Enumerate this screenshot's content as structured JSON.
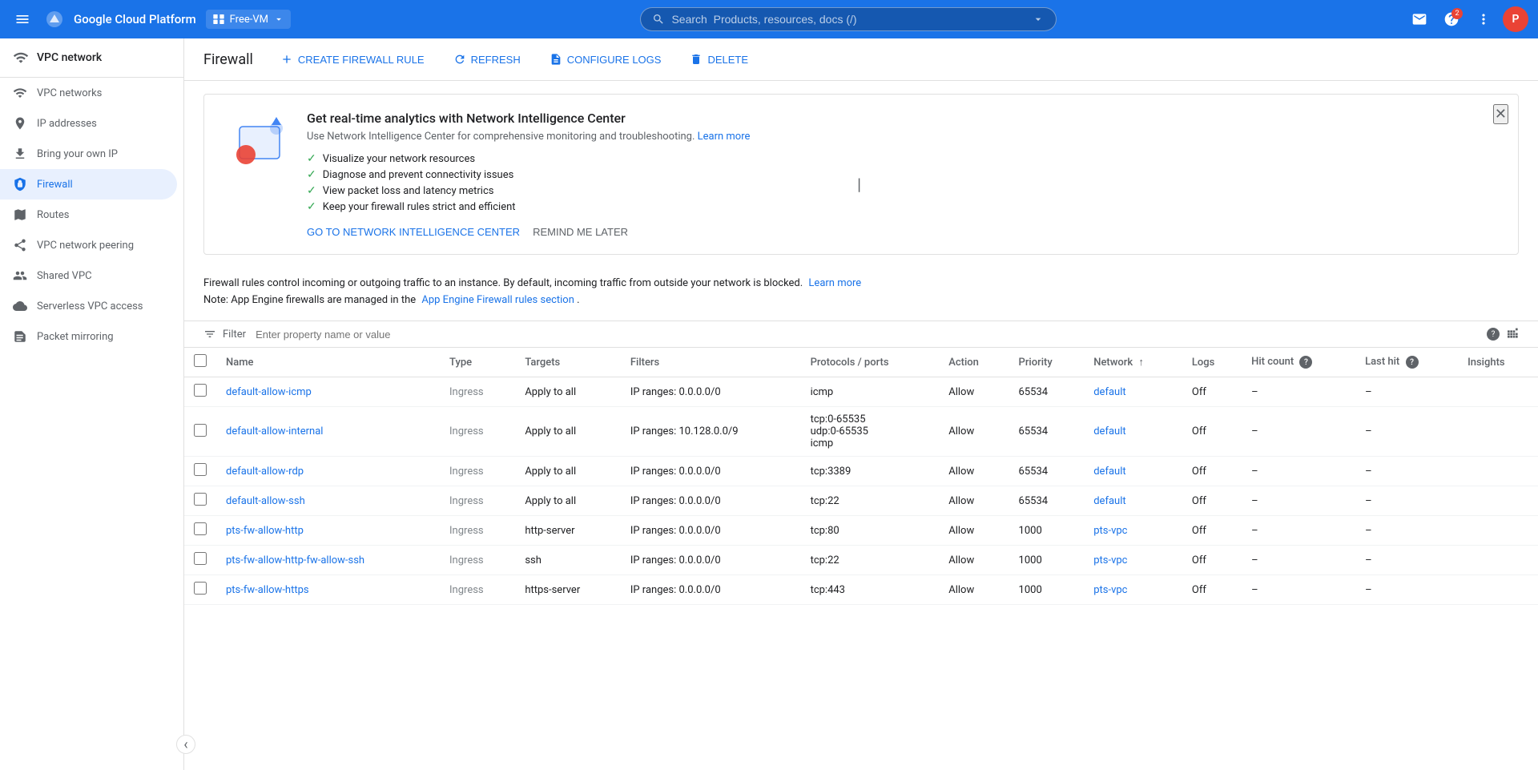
{
  "topbar": {
    "menu_icon": "☰",
    "title": "Google Cloud Platform",
    "project": "Free-VM",
    "search_placeholder": "Search  Products, resources, docs (/)",
    "icons": [
      "✉",
      "?",
      "⋮"
    ],
    "avatar": "P"
  },
  "sidebar": {
    "header": {
      "title": "VPC network"
    },
    "items": [
      {
        "id": "vpc-networks",
        "label": "VPC networks",
        "icon": "network",
        "active": false
      },
      {
        "id": "ip-addresses",
        "label": "IP addresses",
        "icon": "ip",
        "active": false
      },
      {
        "id": "bring-your-own-ip",
        "label": "Bring your own IP",
        "icon": "upload",
        "active": false
      },
      {
        "id": "firewall",
        "label": "Firewall",
        "icon": "shield",
        "active": true
      },
      {
        "id": "routes",
        "label": "Routes",
        "icon": "route",
        "active": false
      },
      {
        "id": "vpc-network-peering",
        "label": "VPC network peering",
        "icon": "peering",
        "active": false
      },
      {
        "id": "shared-vpc",
        "label": "Shared VPC",
        "icon": "shared",
        "active": false
      },
      {
        "id": "serverless-vpc-access",
        "label": "Serverless VPC access",
        "icon": "serverless",
        "active": false
      },
      {
        "id": "packet-mirroring",
        "label": "Packet mirroring",
        "icon": "mirror",
        "active": false
      }
    ]
  },
  "page": {
    "title": "Firewall",
    "toolbar": {
      "create_label": "CREATE FIREWALL RULE",
      "refresh_label": "REFRESH",
      "configure_logs_label": "CONFIGURE LOGS",
      "delete_label": "DELETE"
    },
    "promo": {
      "title": "Get real-time analytics with Network Intelligence Center",
      "subtitle": "Use Network Intelligence Center for comprehensive monitoring and troubleshooting.",
      "subtitle_link": "Learn more",
      "features": [
        "Visualize your network resources",
        "Diagnose and prevent connectivity issues",
        "View packet loss and latency metrics",
        "Keep your firewall rules strict and efficient"
      ],
      "actions": {
        "primary": "GO TO NETWORK INTELLIGENCE CENTER",
        "secondary": "REMIND ME LATER"
      }
    },
    "info": {
      "line1": "Firewall rules control incoming or outgoing traffic to an instance. By default, incoming traffic from outside your network is blocked.",
      "learn_more_1": "Learn more",
      "line2": "Note: App Engine firewalls are managed in the",
      "app_engine_link": "App Engine Firewall rules section",
      "line2_suffix": "."
    },
    "filter": {
      "placeholder": "Enter property name or value"
    },
    "table": {
      "columns": [
        {
          "id": "name",
          "label": "Name"
        },
        {
          "id": "type",
          "label": "Type"
        },
        {
          "id": "targets",
          "label": "Targets"
        },
        {
          "id": "filters",
          "label": "Filters"
        },
        {
          "id": "protocols_ports",
          "label": "Protocols / ports"
        },
        {
          "id": "action",
          "label": "Action"
        },
        {
          "id": "priority",
          "label": "Priority"
        },
        {
          "id": "network",
          "label": "Network",
          "sorted": true
        },
        {
          "id": "logs",
          "label": "Logs"
        },
        {
          "id": "hit_count",
          "label": "Hit count",
          "help": true
        },
        {
          "id": "last_hit",
          "label": "Last hit",
          "help": true
        },
        {
          "id": "insights",
          "label": "Insights"
        }
      ],
      "rows": [
        {
          "name": "default-allow-icmp",
          "type": "Ingress",
          "targets": "Apply to all",
          "filters": "IP ranges: 0.0.0.0/0",
          "protocols_ports": "icmp",
          "action": "Allow",
          "priority": "65534",
          "network": "default",
          "logs": "Off",
          "hit_count": "–",
          "last_hit": "–",
          "insights": ""
        },
        {
          "name": "default-allow-internal",
          "type": "Ingress",
          "targets": "Apply to all",
          "filters": "IP ranges: 10.128.0.0/9",
          "protocols_ports": "tcp:0-65535\nudp:0-65535\nicmp",
          "action": "Allow",
          "priority": "65534",
          "network": "default",
          "logs": "Off",
          "hit_count": "–",
          "last_hit": "–",
          "insights": ""
        },
        {
          "name": "default-allow-rdp",
          "type": "Ingress",
          "targets": "Apply to all",
          "filters": "IP ranges: 0.0.0.0/0",
          "protocols_ports": "tcp:3389",
          "action": "Allow",
          "priority": "65534",
          "network": "default",
          "logs": "Off",
          "hit_count": "–",
          "last_hit": "–",
          "insights": ""
        },
        {
          "name": "default-allow-ssh",
          "type": "Ingress",
          "targets": "Apply to all",
          "filters": "IP ranges: 0.0.0.0/0",
          "protocols_ports": "tcp:22",
          "action": "Allow",
          "priority": "65534",
          "network": "default",
          "logs": "Off",
          "hit_count": "–",
          "last_hit": "–",
          "insights": ""
        },
        {
          "name": "pts-fw-allow-http",
          "type": "Ingress",
          "targets": "http-server",
          "filters": "IP ranges: 0.0.0.0/0",
          "protocols_ports": "tcp:80",
          "action": "Allow",
          "priority": "1000",
          "network": "pts-vpc",
          "logs": "Off",
          "hit_count": "–",
          "last_hit": "–",
          "insights": ""
        },
        {
          "name": "pts-fw-allow-http-fw-allow-ssh",
          "type": "Ingress",
          "targets": "ssh",
          "filters": "IP ranges: 0.0.0.0/0",
          "protocols_ports": "tcp:22",
          "action": "Allow",
          "priority": "1000",
          "network": "pts-vpc",
          "logs": "Off",
          "hit_count": "–",
          "last_hit": "–",
          "insights": ""
        },
        {
          "name": "pts-fw-allow-https",
          "type": "Ingress",
          "targets": "https-server",
          "filters": "IP ranges: 0.0.0.0/0",
          "protocols_ports": "tcp:443",
          "action": "Allow",
          "priority": "1000",
          "network": "pts-vpc",
          "logs": "Off",
          "hit_count": "–",
          "last_hit": "–",
          "insights": ""
        }
      ]
    }
  }
}
